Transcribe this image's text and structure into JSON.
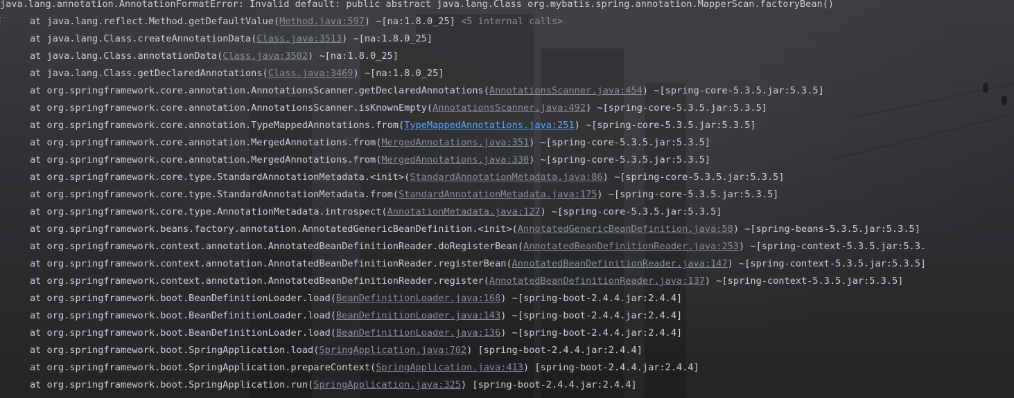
{
  "console": {
    "error_header": "java.lang.annotation.AnnotationFormatError: Invalid default: public abstract java.lang.Class org.mybatis.spring.annotation.MapperScan.factoryBean()",
    "frames": [
      {
        "prefix": "at java.lang.reflect.Method.getDefaultValue(",
        "link": "Method.java:597",
        "suffix": ") ~[na:1.8.0_25] ",
        "extra": "<5 internal calls>"
      },
      {
        "prefix": "at java.lang.Class.createAnnotationData(",
        "link": "Class.java:3513",
        "suffix": ") ~[na:1.8.0_25]"
      },
      {
        "prefix": "at java.lang.Class.annotationData(",
        "link": "Class.java:3502",
        "suffix": ") ~[na:1.8.0_25]"
      },
      {
        "prefix": "at java.lang.Class.getDeclaredAnnotations(",
        "link": "Class.java:3469",
        "suffix": ") ~[na:1.8.0_25]"
      },
      {
        "prefix": "at org.springframework.core.annotation.AnnotationsScanner.getDeclaredAnnotations(",
        "link": "AnnotationsScanner.java:454",
        "suffix": ") ~[spring-core-5.3.5.jar:5.3.5]"
      },
      {
        "prefix": "at org.springframework.core.annotation.AnnotationsScanner.isKnownEmpty(",
        "link": "AnnotationsScanner.java:492",
        "suffix": ") ~[spring-core-5.3.5.jar:5.3.5]"
      },
      {
        "prefix": "at org.springframework.core.annotation.TypeMappedAnnotations.from(",
        "link": "TypeMappedAnnotations.java:251",
        "suffix": ") ~[spring-core-5.3.5.jar:5.3.5]",
        "active": true
      },
      {
        "prefix": "at org.springframework.core.annotation.MergedAnnotations.from(",
        "link": "MergedAnnotations.java:351",
        "suffix": ") ~[spring-core-5.3.5.jar:5.3.5]"
      },
      {
        "prefix": "at org.springframework.core.annotation.MergedAnnotations.from(",
        "link": "MergedAnnotations.java:330",
        "suffix": ") ~[spring-core-5.3.5.jar:5.3.5]"
      },
      {
        "prefix": "at org.springframework.core.type.StandardAnnotationMetadata.<init>(",
        "link": "StandardAnnotationMetadata.java:86",
        "suffix": ") ~[spring-core-5.3.5.jar:5.3.5]"
      },
      {
        "prefix": "at org.springframework.core.type.StandardAnnotationMetadata.from(",
        "link": "StandardAnnotationMetadata.java:175",
        "suffix": ") ~[spring-core-5.3.5.jar:5.3.5]"
      },
      {
        "prefix": "at org.springframework.core.type.AnnotationMetadata.introspect(",
        "link": "AnnotationMetadata.java:127",
        "suffix": ") ~[spring-core-5.3.5.jar:5.3.5]"
      },
      {
        "prefix": "at org.springframework.beans.factory.annotation.AnnotatedGenericBeanDefinition.<init>(",
        "link": "AnnotatedGenericBeanDefinition.java:58",
        "suffix": ") ~[spring-beans-5.3.5.jar:5.3.5]"
      },
      {
        "prefix": "at org.springframework.context.annotation.AnnotatedBeanDefinitionReader.doRegisterBean(",
        "link": "AnnotatedBeanDefinitionReader.java:253",
        "suffix": ") ~[spring-context-5.3.5.jar:5.3."
      },
      {
        "prefix": "at org.springframework.context.annotation.AnnotatedBeanDefinitionReader.registerBean(",
        "link": "AnnotatedBeanDefinitionReader.java:147",
        "suffix": ") ~[spring-context-5.3.5.jar:5.3.5]"
      },
      {
        "prefix": "at org.springframework.context.annotation.AnnotatedBeanDefinitionReader.register(",
        "link": "AnnotatedBeanDefinitionReader.java:137",
        "suffix": ") ~[spring-context-5.3.5.jar:5.3.5]"
      },
      {
        "prefix": "at org.springframework.boot.BeanDefinitionLoader.load(",
        "link": "BeanDefinitionLoader.java:168",
        "suffix": ") ~[spring-boot-2.4.4.jar:2.4.4]"
      },
      {
        "prefix": "at org.springframework.boot.BeanDefinitionLoader.load(",
        "link": "BeanDefinitionLoader.java:143",
        "suffix": ") ~[spring-boot-2.4.4.jar:2.4.4]"
      },
      {
        "prefix": "at org.springframework.boot.BeanDefinitionLoader.load(",
        "link": "BeanDefinitionLoader.java:136",
        "suffix": ") ~[spring-boot-2.4.4.jar:2.4.4]"
      },
      {
        "prefix": "at org.springframework.boot.SpringApplication.load(",
        "link": "SpringApplication.java:702",
        "suffix": ") [spring-boot-2.4.4.jar:2.4.4]"
      },
      {
        "prefix": "at org.springframework.boot.SpringApplication.prepareContext(",
        "link": "SpringApplication.java:413",
        "suffix": ") [spring-boot-2.4.4.jar:2.4.4]"
      },
      {
        "prefix": "at org.springframework.boot.SpringApplication.run(",
        "link": "SpringApplication.java:325",
        "suffix": ") [spring-boot-2.4.4.jar:2.4.4]"
      }
    ]
  },
  "colors": {
    "text": "#cfd2d6",
    "link": "#8a8f96",
    "active_link": "#5aa3ff",
    "background": "#2b2d2f"
  }
}
